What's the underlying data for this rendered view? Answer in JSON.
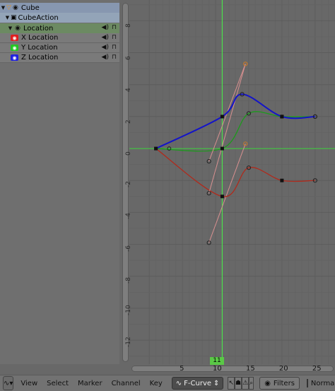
{
  "channels": [
    {
      "label": "Cube",
      "kind": "object"
    },
    {
      "label": "CubeAction",
      "kind": "action"
    },
    {
      "label": "Location",
      "kind": "group"
    },
    {
      "label": "X Location",
      "kind": "fcurve",
      "color": "#e01e1e"
    },
    {
      "label": "Y Location",
      "kind": "fcurve",
      "color": "#22c822"
    },
    {
      "label": "Z Location",
      "kind": "fcurve",
      "color": "#2020e0"
    }
  ],
  "graph": {
    "current_frame": "11",
    "x_ticks": [
      "5",
      "10",
      "15",
      "20",
      "25"
    ],
    "y_ticks": [
      "8",
      "6",
      "4",
      "2",
      "0",
      "-2",
      "-4",
      "-6",
      "-8",
      "-10",
      "-12"
    ]
  },
  "chart_data": {
    "type": "line",
    "xlim": [
      -3,
      28
    ],
    "ylim": [
      -13.5,
      9.3
    ],
    "current_frame": 11,
    "series": [
      {
        "name": "X Location",
        "color": "#b02a1c",
        "points": [
          [
            1,
            0
          ],
          [
            11,
            -3
          ],
          [
            15,
            -1.2
          ],
          [
            20,
            -2
          ],
          [
            25,
            -2
          ]
        ],
        "handles": [
          [
            [
              9,
              -5.9
            ],
            [
              14.5,
              0.3
            ]
          ]
        ]
      },
      {
        "name": "Y Location",
        "color": "#1c9a1c",
        "points": [
          [
            1,
            0
          ],
          [
            11,
            0
          ],
          [
            15,
            2.2
          ],
          [
            20,
            2
          ],
          [
            25,
            2
          ]
        ],
        "handles": [
          [
            [
              9,
              -2.8
            ],
            [
              14.5,
              5.3
            ]
          ]
        ]
      },
      {
        "name": "Z Location",
        "color": "#1414c8",
        "points": [
          [
            1,
            0
          ],
          [
            11,
            2
          ],
          [
            14,
            3.4
          ],
          [
            20,
            2
          ],
          [
            25,
            2
          ]
        ],
        "handles": [
          [
            [
              9,
              -0.8
            ],
            [
              14.5,
              5.3
            ]
          ]
        ]
      }
    ]
  },
  "header": {
    "menu": [
      "View",
      "Select",
      "Marker",
      "Channel",
      "Key"
    ],
    "mode": "F-Curve",
    "filters": "Filters",
    "normalize": "Normaliz"
  }
}
